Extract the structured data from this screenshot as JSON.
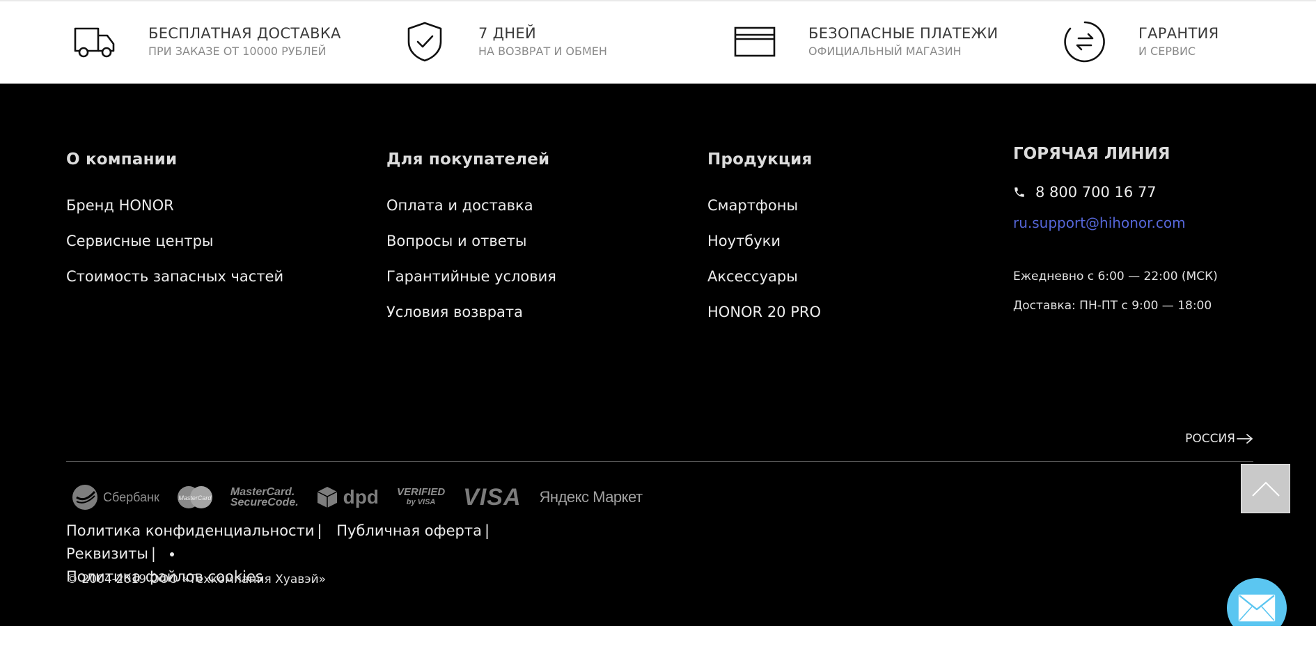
{
  "features": [
    {
      "title": "БЕСПЛАТНАЯ ДОСТАВКА",
      "subtitle": "ПРИ ЗАКАЗЕ ОТ 10000 РУБЛЕЙ",
      "icon": "truck-icon"
    },
    {
      "title": "7 ДНЕЙ",
      "subtitle": "НА ВОЗВРАТ И ОБМЕН",
      "icon": "shield-check-icon"
    },
    {
      "title": "БЕЗОПАСНЫЕ ПЛАТЕЖИ",
      "subtitle": "ОФИЦИАЛЬНЫЙ МАГАЗИН",
      "icon": "card-icon"
    },
    {
      "title": "ГАРАНТИЯ",
      "subtitle": "И СЕРВИС",
      "icon": "exchange-icon"
    }
  ],
  "columns": [
    {
      "heading": "О компании",
      "links": [
        "Бренд HONOR",
        "Сервисные центры",
        "Стоимость запасных частей"
      ]
    },
    {
      "heading": "Для покупателей",
      "links": [
        "Оплата и доставка",
        "Вопросы и ответы",
        "Гарантийные условия",
        "Условия возврата"
      ]
    },
    {
      "heading": "Продукция",
      "links": [
        "Смартфоны",
        "Ноутбуки",
        "Аксессуары",
        "HONOR 20 PRO"
      ]
    }
  ],
  "hotline": {
    "heading": "ГОРЯЧАЯ ЛИНИЯ",
    "phone": "8 800 700 16 77",
    "email": "ru.support@hihonor.com",
    "hours": "Ежедневно с 6:00 — 22:00 (МСК)",
    "delivery": "Доставка: ПН-ПТ с 9:00 — 18:00"
  },
  "region": "РОССИЯ",
  "payments": {
    "sber": "Сбербанк",
    "mastercard": "MasterCard",
    "msc_line1": "MasterCard.",
    "msc_line2": "SecureCode.",
    "dpd": "dpd",
    "vbv_line1": "VERIFIED",
    "vbv_line2": "by VISA",
    "visa": "VISA",
    "ym": "Яндекс Маркет"
  },
  "legal": {
    "privacy": "Политика конфиденциальности",
    "offer": "Публичная оферта",
    "requisites": "Реквизиты",
    "sep": "|",
    "cookies": "Политика файлов cookies"
  },
  "copyright": "© 2004-2019 ООО «Техкомпания Хуавэй»",
  "colors": {
    "footer_bg": "#000000",
    "email": "#5566d8",
    "chat": "#5bc6f1",
    "scroll_top": "#c9c9c9"
  }
}
